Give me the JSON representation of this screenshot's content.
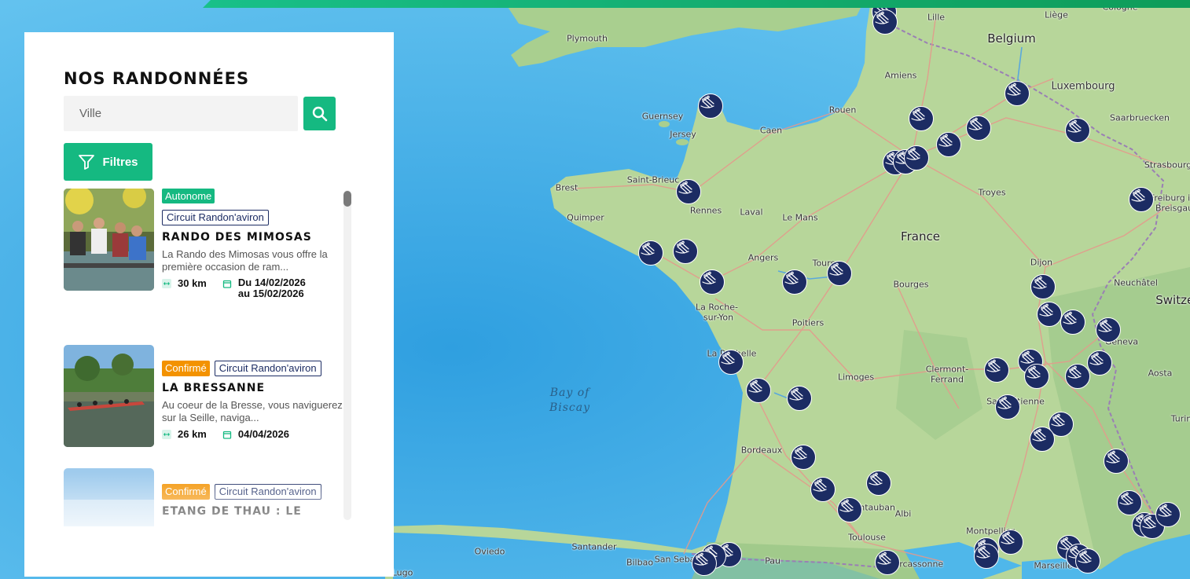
{
  "sidebar": {
    "title": "NOS RANDONNÉES",
    "search": {
      "placeholder": "Ville",
      "value": ""
    },
    "search_button_icon": "search-icon",
    "filter_button": {
      "label": "Filtres",
      "icon": "funnel-icon"
    },
    "hikes": [
      {
        "level": "Autonome",
        "level_color": "#15b981",
        "type": "Circuit Randon'aviron",
        "title": "RANDO DES MIMOSAS",
        "description": "La Rando des Mimosas vous offre la première occasion de ram...",
        "distance": "30 km",
        "date_line1": "Du 14/02/2026",
        "date_line2": "au 15/02/2026"
      },
      {
        "level": "Confirmé",
        "level_color": "#f39200",
        "type": "Circuit Randon'aviron",
        "title": "LA BRESSANNE",
        "description": "Au coeur de la Bresse, vous naviguerez sur la Seille, naviga...",
        "distance": "26 km",
        "date_line1": "04/04/2026",
        "date_line2": ""
      },
      {
        "level": "Confirmé",
        "level_color": "#f39200",
        "type": "Circuit Randon'aviron",
        "title": "ETANG DE THAU : LE",
        "description": "",
        "distance": "",
        "date_line1": "",
        "date_line2": ""
      }
    ]
  },
  "map": {
    "marker_icon": "rowing-boat-icon",
    "marker_color": "#1c2c63",
    "accent_color": "#15b981",
    "labels": {
      "belgium": "Belgium",
      "luxembourg": "Luxembourg",
      "france": "France",
      "bay": "Bay of",
      "bay2": "Biscay",
      "guernsey": "Guernsey",
      "jersey": "Jersey",
      "plymouth": "Plymouth",
      "lille": "Lille",
      "liege": "Liège",
      "cologne": "Cologne",
      "amiens": "Amiens",
      "rouen": "Rouen",
      "caen": "Caen",
      "saarbrucken": "Saarbruecken",
      "strasbourg": "Strasbourg",
      "brest": "Brest",
      "saintbrieuc": "Saint-Brieuc",
      "rennes": "Rennes",
      "laval": "Laval",
      "lemans": "Le Mans",
      "troyes": "Troyes",
      "freiburg": "Freiburg in",
      "breisgau": "Breisgau",
      "quimper": "Quimper",
      "angers": "Angers",
      "tours": "Tours",
      "bourges": "Bourges",
      "dijon": "Dijon",
      "neuchatel": "Neuchâtel",
      "larochesuryon": "La Roche-",
      "suryon": "sur-Yon",
      "poitiers": "Poitiers",
      "geneva": "Geneva",
      "larochelle": "La Rochelle",
      "limoges": "Limoges",
      "clermont": "Clermont-",
      "ferrand": "Ferrand",
      "saintetienne": "Saint-Étienne",
      "aosta": "Aosta",
      "turin": "Turin",
      "bordeaux": "Bordeaux",
      "montauban": "Montauban",
      "albi": "Albi",
      "toulouse": "Toulouse",
      "montpellier": "Montpellier",
      "marseille": "Marseille",
      "carcassonne": "Carcassonne",
      "pau": "Pau",
      "sansebastian": "San Sebastián",
      "bilbao": "Bilbao",
      "santander": "Santander",
      "oviedo": "Oviedo",
      "lugo": "Lugo",
      "switzerland": "Switzerland"
    }
  }
}
